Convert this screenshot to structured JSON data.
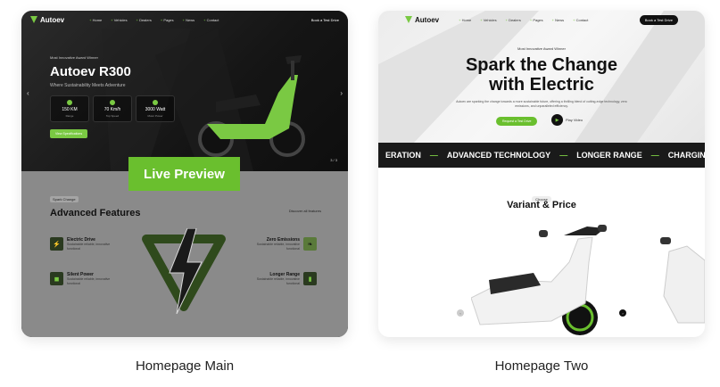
{
  "cards": [
    {
      "caption": "Homepage Main",
      "brand": "Autoev",
      "menu": [
        "Home",
        "Vehicles",
        "Dealers",
        "Pages",
        "News",
        "Contact"
      ],
      "cta": "Book a Test Drive",
      "badge": "Most Innovative Award Winner",
      "title": "Autoev R300",
      "subtitle": "Where Sustainability Meets Adventure",
      "stats": [
        {
          "value": "150 KM",
          "unit": "Range"
        },
        {
          "value": "70 Km/h",
          "unit": "Top Speed"
        },
        {
          "value": "3000 Watt",
          "unit": "Motor Power"
        }
      ],
      "button": "View Specifications",
      "pager": "3 / 3",
      "overlay": "Live Preview",
      "section_tag": "Spark Change",
      "section_title": "Advanced Features",
      "discover": "Discover all features",
      "features": [
        {
          "name": "Electric Drive",
          "desc": "Sustainable reliable, innovative functional"
        },
        {
          "name": "Silent Power",
          "desc": "Sustainable reliable, innovative functional"
        },
        {
          "name": "Zero Emissions",
          "desc": "Sustainable reliable, innovative functional"
        },
        {
          "name": "Longer Range",
          "desc": "Sustainable reliable, innovative functional"
        }
      ]
    },
    {
      "caption": "Homepage Two",
      "brand": "Autoev",
      "menu": [
        "Home",
        "Vehicles",
        "Dealers",
        "Pages",
        "News",
        "Contact"
      ],
      "cta": "Book a Test Drive",
      "badge": "Most Innovative Award Winner",
      "title_line1": "Spark the Change",
      "title_line2": "with Electric",
      "desc": "Autoev are sparking the change towards a more sustainable future, offering a thrilling blend of cutting-edge technology, zero emissions, and unparalleled efficiency.",
      "button": "Request a Test Drive",
      "play": "Play Video",
      "marquee": [
        "ERATION",
        "ADVANCED TECHNOLOGY",
        "LONGER RANGE",
        "CHARGING P"
      ],
      "choose": "Choose",
      "section_title": "Variant & Price"
    }
  ],
  "colors": {
    "accent": "#6abf2e",
    "dark": "#1a1a1a"
  }
}
